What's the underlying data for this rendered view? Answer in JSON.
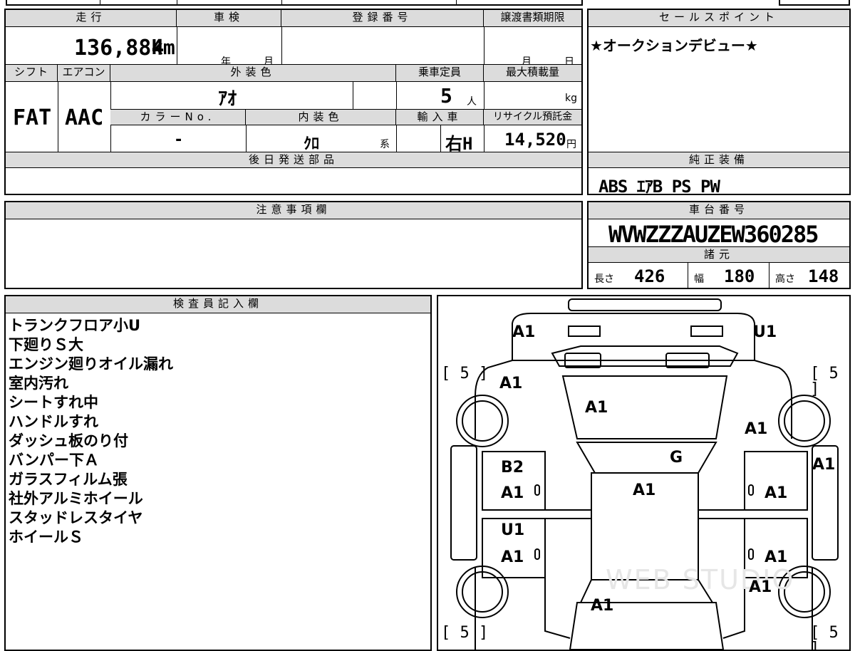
{
  "mileage": {
    "label": "走行",
    "value": "136,884",
    "unit": "km"
  },
  "inspection": {
    "label": "車検",
    "year_unit": "年",
    "month_unit": "月"
  },
  "registration": {
    "label": "登録番号"
  },
  "transfer_deadline": {
    "label": "譲渡書類期限",
    "month_unit": "月",
    "day_unit": "日"
  },
  "sales_point": {
    "label": "セールスポイント",
    "text": "★オークションデビュー★"
  },
  "shift": {
    "label": "シフト",
    "value": "FAT"
  },
  "aircon": {
    "label": "エアコン",
    "value": "AAC"
  },
  "exterior_color": {
    "label": "外装色",
    "value": "ｱｵ"
  },
  "capacity": {
    "label": "乗車定員",
    "value": "5",
    "unit": "人"
  },
  "max_load": {
    "label": "最大積載量",
    "unit": "kg"
  },
  "color_no": {
    "label": "カラーNo.",
    "value": "-"
  },
  "interior_color": {
    "label": "内装色",
    "value": "ｸﾛ",
    "suffix": "系"
  },
  "import": {
    "label": "輸入車",
    "value": "右H"
  },
  "recycle_fee": {
    "label": "リサイクル預託金",
    "value": "14,520",
    "unit": "円"
  },
  "later_parts": {
    "label": "後日発送部品"
  },
  "equipment": {
    "label": "純正装備",
    "value": "ABS ｴｱB PS PW"
  },
  "caution": {
    "label": "注意事項欄"
  },
  "chassis": {
    "label": "車台番号",
    "value": "WVWZZZAUZEW360285"
  },
  "specs": {
    "label": "諸元",
    "length_label": "長さ",
    "length": "426",
    "width_label": "幅",
    "width": "180",
    "height_label": "高さ",
    "height": "148"
  },
  "inspector": {
    "label": "検査員記入欄",
    "notes": [
      "トランクフロア小U",
      "下廻りＳ大",
      "エンジン廻りオイル漏れ",
      "室内汚れ",
      "シートすれ中",
      "ハンドルすれ",
      "ダッシュ板のり付",
      "バンパー下Ａ",
      "ガラスフィルム張",
      "社外アルミホイール",
      "スタッドレスタイヤ",
      "ホイールＳ"
    ]
  },
  "diagram": {
    "tire_depth": "5",
    "marks": {
      "rear_left": "A1",
      "rear_right": "U1",
      "rear_door_top": "A1",
      "rear_glass": "A1",
      "right_rear_fender": "A1",
      "roof_glass": "G",
      "right_quarter": "A1",
      "left_rear_door_1": "B2",
      "left_rear_door_2": "A1",
      "roof": "A1",
      "right_rear_door": "A1",
      "left_front_door_1": "U1",
      "left_front_door_2": "A1",
      "right_front_door": "A1",
      "right_front_fender": "A1",
      "hood": "A1",
      "zero_mark": "0"
    },
    "watermark": "WEB STUDIO"
  }
}
